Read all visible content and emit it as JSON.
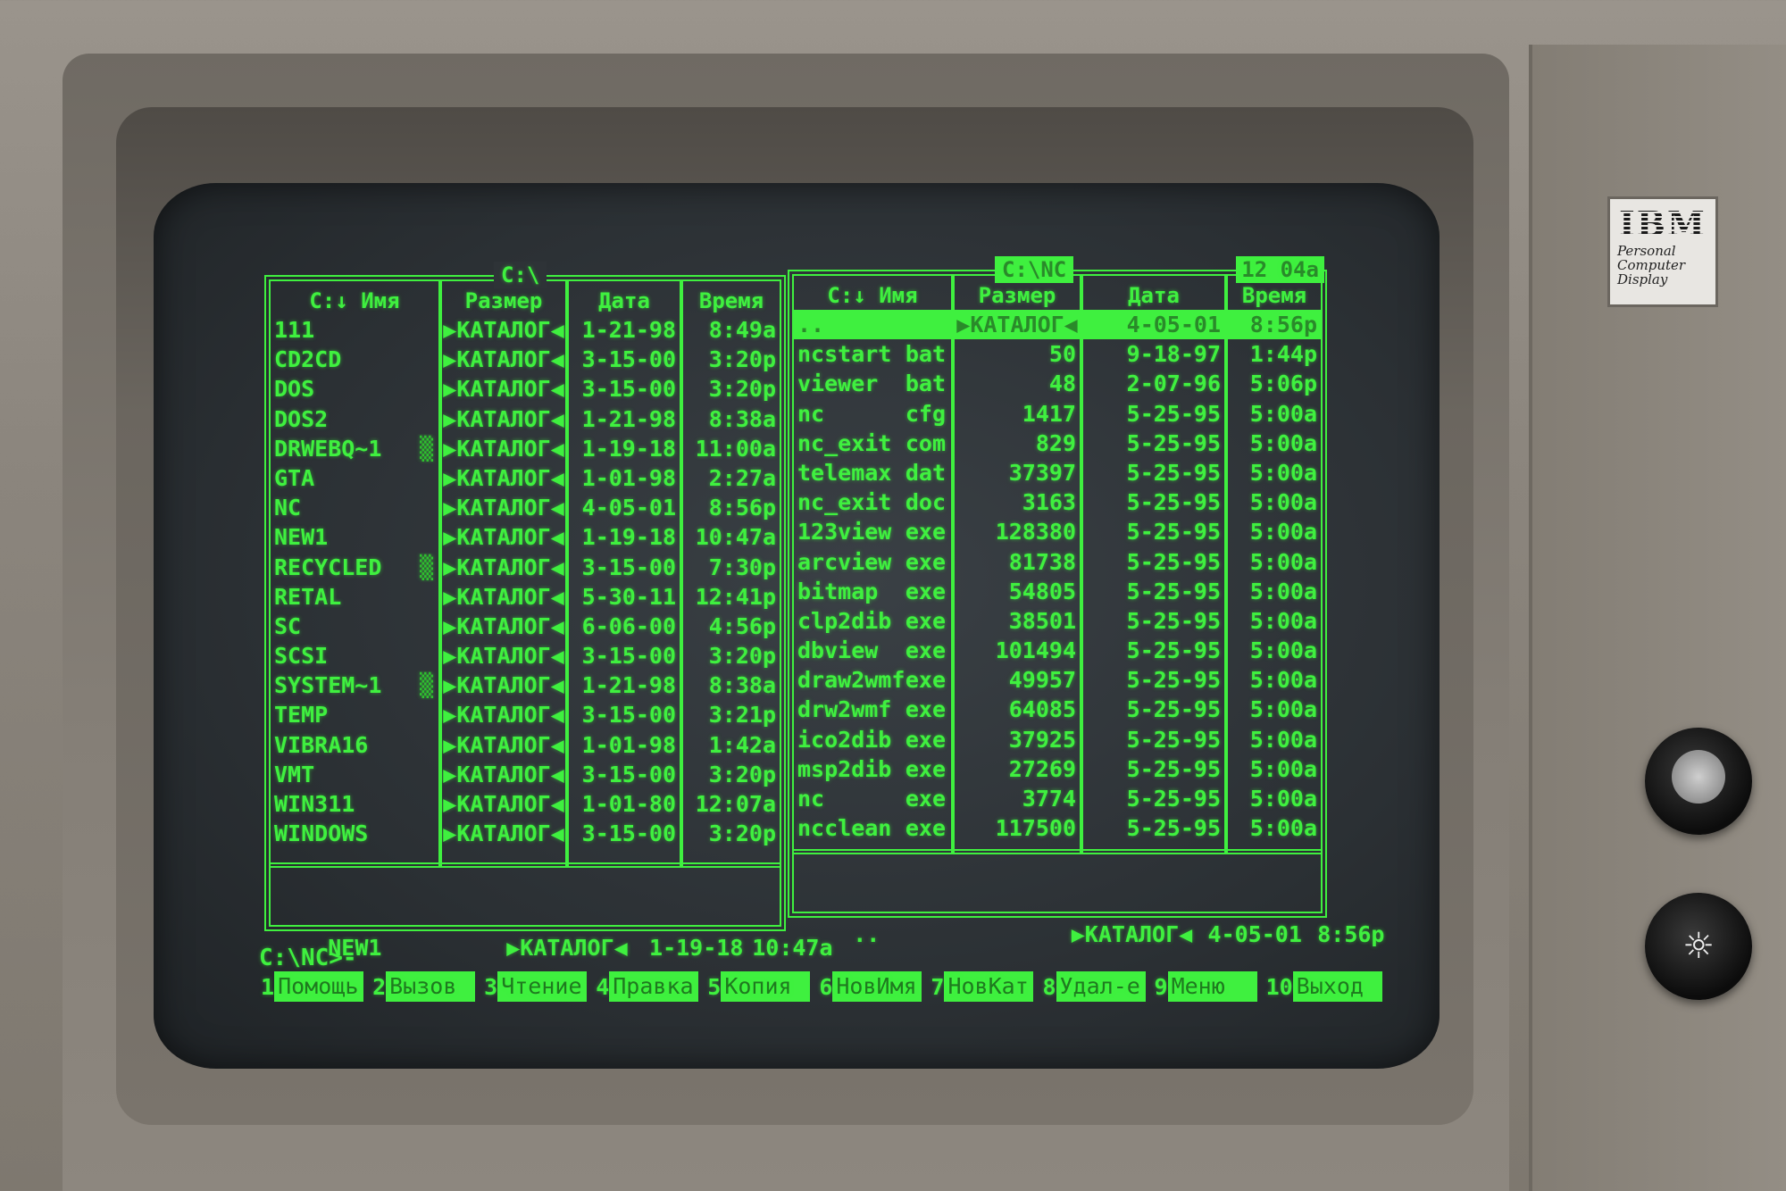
{
  "badge": {
    "brand": "IBM",
    "line1": "Personal",
    "line2": "Computer",
    "line3": "Display"
  },
  "knobs": [
    {
      "icon": "contrast-icon",
      "glyph": "◐"
    },
    {
      "icon": "brightness-icon",
      "glyph": "☼"
    }
  ],
  "colors": {
    "phosphor": "#3ff03f",
    "screen": "#2e3337",
    "bezel": "#8b857d"
  },
  "left_panel": {
    "path": "C:\\",
    "headers": {
      "name": "C:↓ Имя",
      "size": "Размер",
      "date": "Дата",
      "time": "Время"
    },
    "rows": [
      {
        "name": "111",
        "size": "▶КАТАЛОГ◀",
        "date": "1-21-98",
        "time": "8:49a"
      },
      {
        "name": "CD2CD",
        "size": "▶КАТАЛОГ◀",
        "date": "3-15-00",
        "time": "3:20p"
      },
      {
        "name": "DOS",
        "size": "▶КАТАЛОГ◀",
        "date": "3-15-00",
        "time": "3:20p"
      },
      {
        "name": "DOS2",
        "size": "▶КАТАЛОГ◀",
        "date": "1-21-98",
        "time": "8:38a"
      },
      {
        "name": "DRWEBQ~1",
        "hidden": "▒",
        "size": "▶КАТАЛОГ◀",
        "date": "1-19-18",
        "time": "11:00a"
      },
      {
        "name": "GTA",
        "size": "▶КАТАЛОГ◀",
        "date": "1-01-98",
        "time": "2:27a"
      },
      {
        "name": "NC",
        "size": "▶КАТАЛОГ◀",
        "date": "4-05-01",
        "time": "8:56p"
      },
      {
        "name": "NEW1",
        "size": "▶КАТАЛОГ◀",
        "date": "1-19-18",
        "time": "10:47a"
      },
      {
        "name": "RECYCLED",
        "hidden": "▒",
        "size": "▶КАТАЛОГ◀",
        "date": "3-15-00",
        "time": "7:30p"
      },
      {
        "name": "RETAL",
        "size": "▶КАТАЛОГ◀",
        "date": "5-30-11",
        "time": "12:41p"
      },
      {
        "name": "SC",
        "size": "▶КАТАЛОГ◀",
        "date": "6-06-00",
        "time": "4:56p"
      },
      {
        "name": "SCSI",
        "size": "▶КАТАЛОГ◀",
        "date": "3-15-00",
        "time": "3:20p"
      },
      {
        "name": "SYSTEM~1",
        "hidden": "▒",
        "size": "▶КАТАЛОГ◀",
        "date": "1-21-98",
        "time": "8:38a"
      },
      {
        "name": "TEMP",
        "size": "▶КАТАЛОГ◀",
        "date": "3-15-00",
        "time": "3:21p"
      },
      {
        "name": "VIBRA16",
        "size": "▶КАТАЛОГ◀",
        "date": "1-01-98",
        "time": "1:42a"
      },
      {
        "name": "VMT",
        "size": "▶КАТАЛОГ◀",
        "date": "3-15-00",
        "time": "3:20p"
      },
      {
        "name": "WIN311",
        "size": "▶КАТАЛОГ◀",
        "date": "1-01-80",
        "time": "12:07a"
      },
      {
        "name": "WINDOWS",
        "size": "▶КАТАЛОГ◀",
        "date": "3-15-00",
        "time": "3:20p"
      }
    ],
    "status": {
      "name": "NEW1",
      "size": "▶КАТАЛОГ◀",
      "date": "1-19-18",
      "time": "10:47a"
    }
  },
  "right_panel": {
    "path": "C:\\NC",
    "clock": "12 04a",
    "headers": {
      "name": "C:↓ Имя",
      "size": "Размер",
      "date": "Дата",
      "time": "Время"
    },
    "selected": {
      "name": "..",
      "size": "▶КАТАЛОГ◀",
      "date": "4-05-01",
      "time": "8:56p"
    },
    "rows": [
      {
        "name": "ncstart",
        "ext": "bat",
        "size": "50",
        "date": "9-18-97",
        "time": "1:44p"
      },
      {
        "name": "viewer",
        "ext": "bat",
        "size": "48",
        "date": "2-07-96",
        "time": "5:06p"
      },
      {
        "name": "nc",
        "ext": "cfg",
        "size": "1417",
        "date": "5-25-95",
        "time": "5:00a"
      },
      {
        "name": "nc_exit",
        "ext": "com",
        "size": "829",
        "date": "5-25-95",
        "time": "5:00a"
      },
      {
        "name": "telemax",
        "ext": "dat",
        "size": "37397",
        "date": "5-25-95",
        "time": "5:00a"
      },
      {
        "name": "nc_exit",
        "ext": "doc",
        "size": "3163",
        "date": "5-25-95",
        "time": "5:00a"
      },
      {
        "name": "123view",
        "ext": "exe",
        "size": "128380",
        "date": "5-25-95",
        "time": "5:00a"
      },
      {
        "name": "arcview",
        "ext": "exe",
        "size": "81738",
        "date": "5-25-95",
        "time": "5:00a"
      },
      {
        "name": "bitmap",
        "ext": "exe",
        "size": "54805",
        "date": "5-25-95",
        "time": "5:00a"
      },
      {
        "name": "clp2dib",
        "ext": "exe",
        "size": "38501",
        "date": "5-25-95",
        "time": "5:00a"
      },
      {
        "name": "dbview",
        "ext": "exe",
        "size": "101494",
        "date": "5-25-95",
        "time": "5:00a"
      },
      {
        "name": "draw2wmf",
        "ext": "exe",
        "size": "49957",
        "date": "5-25-95",
        "time": "5:00a"
      },
      {
        "name": "drw2wmf",
        "ext": "exe",
        "size": "64085",
        "date": "5-25-95",
        "time": "5:00a"
      },
      {
        "name": "ico2dib",
        "ext": "exe",
        "size": "37925",
        "date": "5-25-95",
        "time": "5:00a"
      },
      {
        "name": "msp2dib",
        "ext": "exe",
        "size": "27269",
        "date": "5-25-95",
        "time": "5:00a"
      },
      {
        "name": "nc",
        "ext": "exe",
        "size": "3774",
        "date": "5-25-95",
        "time": "5:00a"
      },
      {
        "name": "ncclean",
        "ext": "exe",
        "size": "117500",
        "date": "5-25-95",
        "time": "5:00a"
      }
    ],
    "status": {
      "name": "..",
      "size": "▶КАТАЛОГ◀",
      "date": "4-05-01",
      "time": "8:56p"
    }
  },
  "prompt": "C:\\NC>-",
  "keys": [
    {
      "num": "1",
      "label": "Помощь"
    },
    {
      "num": "2",
      "label": "Вызов"
    },
    {
      "num": "3",
      "label": "Чтение"
    },
    {
      "num": "4",
      "label": "Правка"
    },
    {
      "num": "5",
      "label": "Копия"
    },
    {
      "num": "6",
      "label": "НовИмя"
    },
    {
      "num": "7",
      "label": "НовКат"
    },
    {
      "num": "8",
      "label": "Удал-е"
    },
    {
      "num": "9",
      "label": "Меню"
    },
    {
      "num": "10",
      "label": "Выход"
    }
  ]
}
